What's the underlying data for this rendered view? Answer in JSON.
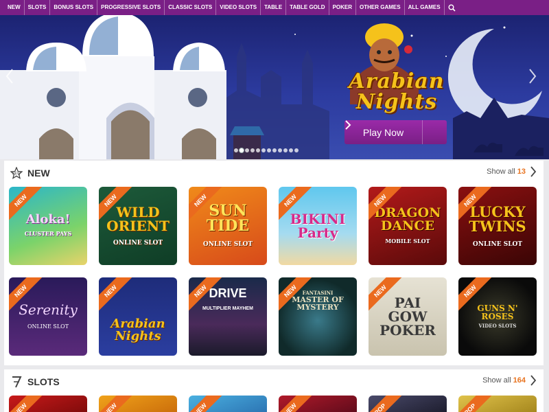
{
  "nav": {
    "items": [
      "NEW",
      "SLOTS",
      "BONUS SLOTS",
      "PROGRESSIVE SLOTS",
      "CLASSIC SLOTS",
      "VIDEO SLOTS",
      "TABLE",
      "TABLE GOLD",
      "POKER",
      "OTHER GAMES",
      "ALL GAMES"
    ],
    "search_icon": "search-icon"
  },
  "hero": {
    "title_line1": "Arabian",
    "title_line2": "Nights",
    "play_label": "Play Now",
    "slides": 12,
    "active_slide": 2
  },
  "new_section": {
    "title": "NEW",
    "show_all": "Show all",
    "count": "13",
    "badge": "NEW",
    "games": [
      {
        "name": "Aloka!",
        "sub": "CLUSTER PAYS"
      },
      {
        "name": "WILD ORIENT",
        "sub": "ONLINE SLOT"
      },
      {
        "name": "SUN TIDE",
        "sub": "ONLINE SLOT"
      },
      {
        "name": "BIKINI Party",
        "sub": ""
      },
      {
        "name": "DRAGON DANCE",
        "sub": "MOBILE SLOT"
      },
      {
        "name": "LUCKY TWINS",
        "sub": "ONLINE SLOT"
      },
      {
        "name": "Serenity",
        "sub": "ONLINE SLOT"
      },
      {
        "name": "Arabian Nights",
        "sub": ""
      },
      {
        "name": "DRIVE",
        "sub": "MULTIPLIER MAYHEM"
      },
      {
        "name": "MASTER OF MYSTERY",
        "sub": "FANTASINI"
      },
      {
        "name": "PAI GOW POKER",
        "sub": ""
      },
      {
        "name": "GUNS N' ROSES",
        "sub": "VIDEO SLOTS"
      }
    ]
  },
  "slots_section": {
    "title": "SLOTS",
    "show_all": "Show all",
    "count": "164",
    "badges": [
      "NEW",
      "NEW",
      "NEW",
      "NEW",
      "POP",
      "POP"
    ]
  },
  "colors": {
    "nav_bg": "#7a1f86",
    "accent_orange": "#e8731f",
    "play_button": "#8e2499"
  }
}
